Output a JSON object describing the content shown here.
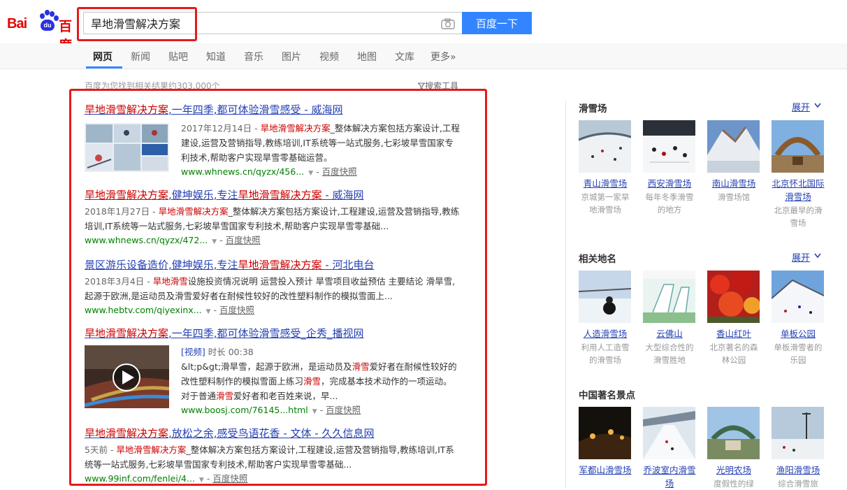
{
  "header": {
    "logo": {
      "bai": "Bai",
      "du": "du",
      "du_text": "百度"
    },
    "search_value": "旱地滑雪解决方案",
    "search_button": "百度一下",
    "camera_icon": "camera-icon"
  },
  "nav": {
    "tabs": [
      "网页",
      "新闻",
      "贴吧",
      "知道",
      "音乐",
      "图片",
      "视频",
      "地图",
      "文库",
      "更多»"
    ]
  },
  "results_meta": {
    "count_text": "百度为您找到相关结果约303,000个",
    "tools_text": "搜索工具",
    "cache_label": "百度快照"
  },
  "results": [
    {
      "title_em": "旱地滑雪解决方案",
      "title_rest": ",一年四季,都可体验滑雪感受 - 威海网",
      "date": "2017年12月14日 - ",
      "abs_em": "旱地滑雪解决方案",
      "abs_rest": "_整体解决方案包括方案设计,工程建设,运营及营销指导,教练培训,IT系统等一站式服务,七彩坡旱雪国家专利技术,帮助客户实现旱雪零基础运营。",
      "url": "www.whnews.cn/qyzx/456..."
    },
    {
      "title_em": "旱地滑雪解决方案",
      "title_mid": ",健坤娱乐,专注",
      "title_em2": "旱地滑雪解决方案",
      "title_rest": " - 威海网",
      "date": "2018年1月27日 - ",
      "abs_em": "旱地滑雪解决方案",
      "abs_rest": "_整体解决方案包括方案设计,工程建设,运营及营销指导,教练培训,IT系统等一站式服务,七彩坡旱雪国家专利技术,帮助客户实现旱雪零基础...",
      "url": "www.whnews.cn/qyzx/472..."
    },
    {
      "title_pre": "景区游乐设备造价,健坤娱乐,专注",
      "title_em": "旱地滑雪解决方案",
      "title_rest": " - 河北电台",
      "date": "2018年3月4日 - ",
      "abs_em": "旱地滑雪",
      "abs_rest": "设施投资情况说明 运营投入预计 旱雪项目收益预估 主要结论 滑旱雪,起源于欧洲,是运动员及滑雪爱好者在耐候性较好的改性塑料制作的模拟雪面上...",
      "url": "www.hebtv.com/qiyexinx..."
    },
    {
      "title_em": "旱地滑雪解决方案",
      "title_rest": ",一年四季,都可体验滑雪感受_企秀_播视网",
      "video_tag": "[视频]",
      "duration": "时长 00:38",
      "abs_a": "&lt;p&gt;滑旱雪，起源于欧洲，是运动员及",
      "abs_em1": "滑雪",
      "abs_b": "爱好者在耐候性较好的改性塑料制作的模拟雪面上练习",
      "abs_em2": "滑雪",
      "abs_c": "，完成基本技术动作的一项运动。对于普通",
      "abs_em3": "滑雪",
      "abs_d": "爱好者和老百姓来说，早...",
      "url": "www.boosj.com/76145...html"
    },
    {
      "title_em": "旱地滑雪解决方案",
      "title_rest": ",放松之余,感受鸟语花香 - 文体 - 久久信息网",
      "date": "5天前 - ",
      "abs_em": "旱地滑雪解决方案",
      "abs_rest": "_整体解决方案包括方案设计,工程建设,运营及营销指导,教练培训,IT系统等一站式服务,七彩坡旱雪国家专利技术,帮助客户实现旱雪零基础...",
      "url": "www.99inf.com/fenlei/4..."
    }
  ],
  "sidebar": {
    "expand_label": "展开",
    "sections": [
      {
        "title": "滑雪场",
        "cards": [
          {
            "name": "青山滑雪场",
            "desc": "京城第一家旱地滑雪场"
          },
          {
            "name": "西安滑雪场",
            "desc": "每年冬季滑雪的地方"
          },
          {
            "name": "南山滑雪场",
            "desc": "滑雪场馆"
          },
          {
            "name": "北京怀北国际滑雪场",
            "desc": "北京最早的滑雪场"
          }
        ]
      },
      {
        "title": "相关地名",
        "cards": [
          {
            "name": "人造滑雪场",
            "desc": "利用人工造雪的滑雪场"
          },
          {
            "name": "云佛山",
            "desc": "大型综合性的滑雪胜地"
          },
          {
            "name": "香山红叶",
            "desc": "北京著名的森林公园"
          },
          {
            "name": "单板公园",
            "desc": "单板滑雪者的乐园"
          }
        ]
      },
      {
        "title": "中国著名景点",
        "cards": [
          {
            "name": "军都山滑雪场",
            "desc": ""
          },
          {
            "name": "乔波室内滑雪场",
            "desc": ""
          },
          {
            "name": "光明农场",
            "desc": "度假性的绿"
          },
          {
            "name": "渔阳滑雪场",
            "desc": "综合滑雪旅"
          }
        ]
      }
    ]
  }
}
